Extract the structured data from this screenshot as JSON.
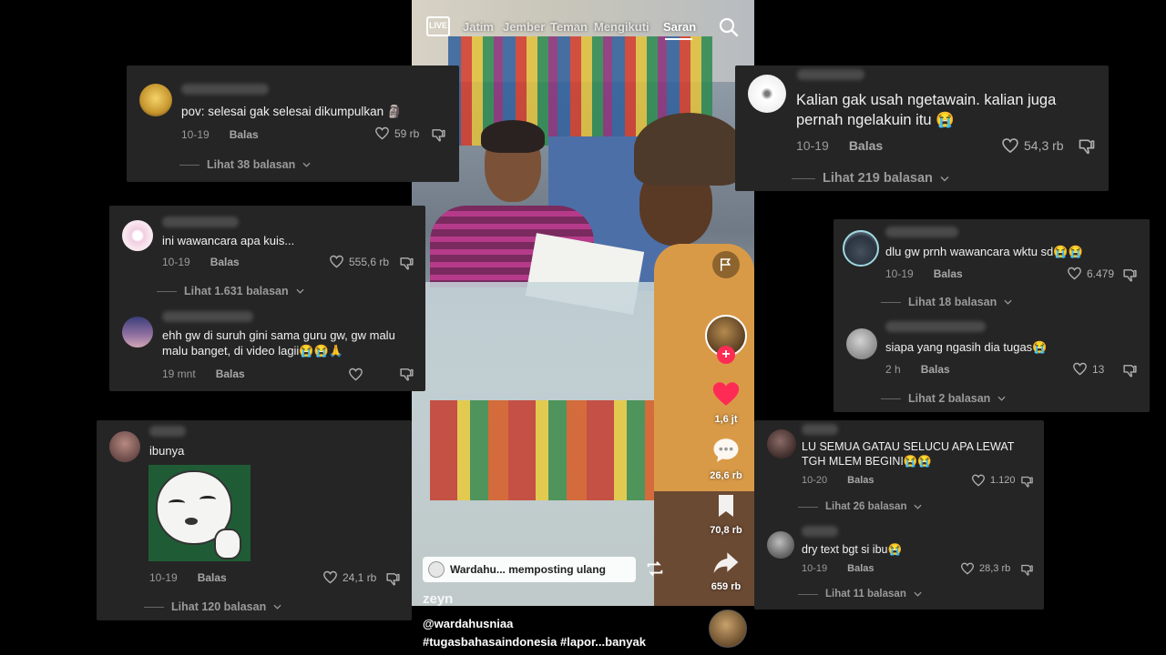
{
  "video": {
    "nav": {
      "live": "LIVE",
      "items": [
        "Jatim",
        "Jember",
        "Teman",
        "Mengikuti",
        "Saran"
      ]
    },
    "actions": {
      "likes": "1,6 jt",
      "comments": "26,6 rb",
      "saves": "70,8 rb",
      "shares": "659 rb"
    },
    "repost_text": "Wardahu... memposting ulang",
    "watermark": "zeyn",
    "caption_user": "@wardahusniaa",
    "caption_tags": "#tugasbahasaindonesia #lapor...banyak"
  },
  "comments": [
    {
      "text": "pov: selesai gak selesai dikumpulkan 🗿",
      "date": "10-19",
      "reply": "Balas",
      "likes": "59 rb",
      "more": "Lihat 38 balasan"
    },
    {
      "text": "ini wawancara apa kuis...",
      "date": "10-19",
      "reply": "Balas",
      "likes": "555,6 rb",
      "more": "Lihat 1.631 balasan"
    },
    {
      "text": "ehh gw di suruh gini sama guru gw, gw malu malu banget, di video lagii😭😭🙏",
      "date": "19 mnt",
      "reply": "Balas",
      "likes": ""
    },
    {
      "text": "ibunya",
      "date": "10-19",
      "reply": "Balas",
      "likes": "24,1 rb",
      "more": "Lihat 120 balasan"
    },
    {
      "text": "Kalian gak usah ngetawain. kalian juga pernah ngelakuin itu 😭",
      "date": "10-19",
      "reply": "Balas",
      "likes": "54,3 rb",
      "more": "Lihat 219 balasan"
    },
    {
      "text": "dlu gw prnh wawancara wktu sd😭😭",
      "date": "10-19",
      "reply": "Balas",
      "likes": "6.479",
      "more": "Lihat 18 balasan"
    },
    {
      "text": "siapa yang ngasih dia tugas😭",
      "date": "2 h",
      "reply": "Balas",
      "likes": "13",
      "more": "Lihat 2 balasan"
    },
    {
      "text": "LU SEMUA GATAU SELUCU APA LEWAT TGH MLEM BEGINI😭😭",
      "date": "10-20",
      "reply": "Balas",
      "likes": "1.120",
      "more": "Lihat 26 balasan"
    },
    {
      "text": "dry text bgt si ibu😭",
      "date": "10-19",
      "reply": "Balas",
      "likes": "28,3 rb",
      "more": "Lihat 11 balasan"
    }
  ]
}
